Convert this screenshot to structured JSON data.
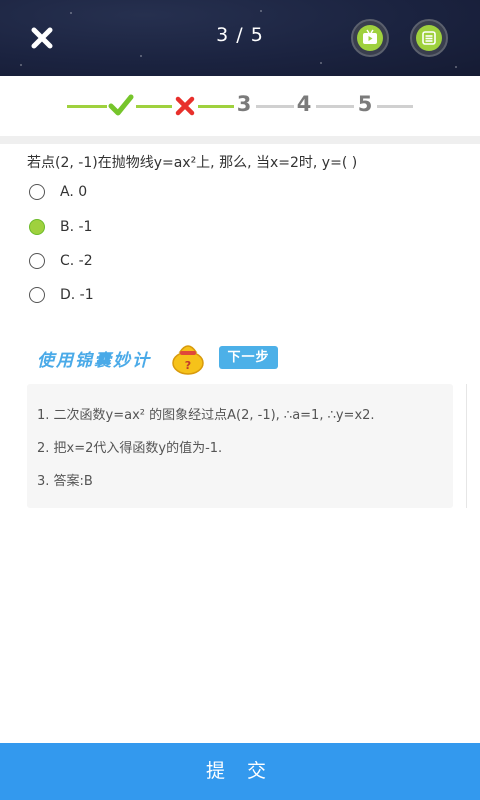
{
  "header": {
    "counter": "3 / 5",
    "close_icon": "close-x-icon",
    "video_icon": "tv-play-icon",
    "menu_icon": "list-menu-icon"
  },
  "progress": {
    "steps": [
      {
        "state": "correct",
        "icon": "check-icon"
      },
      {
        "state": "wrong",
        "icon": "cross-icon"
      },
      {
        "label": "3"
      },
      {
        "label": "4"
      },
      {
        "label": "5"
      }
    ],
    "colors": {
      "done": "#9fd13e",
      "pending": "#d0d0d0",
      "check": "#76c52b",
      "cross": "#e8302c"
    }
  },
  "question": {
    "text": "若点(2, -1)在抛物线y=ax²上, 那么, 当x=2时, y=( )",
    "options": [
      {
        "label": "A. 0",
        "selected": false
      },
      {
        "label": "B. -1",
        "selected": true
      },
      {
        "label": "C. -2",
        "selected": false
      },
      {
        "label": "D. -1",
        "selected": false
      }
    ]
  },
  "tips": {
    "title": "使用锦囊妙计",
    "next_label": "下一步",
    "bag_icon": "lucky-bag-icon"
  },
  "solution": {
    "steps": [
      "1. 二次函数y=ax² 的图象经过点A(2, -1), ∴a=1, ∴y=x2.",
      "2. 把x=2代入得函数y的值为-1.",
      "3. 答案:B"
    ]
  },
  "submit": {
    "label": "提 交"
  },
  "colors": {
    "header_bg": "#1b2340",
    "accent_blue": "#3399ee",
    "accent_green": "#9fd13e"
  }
}
